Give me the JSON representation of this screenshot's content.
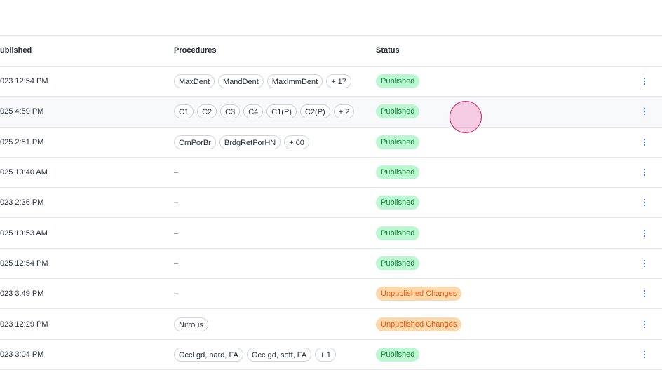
{
  "columns": {
    "published": "ublished",
    "procedures": "Procedures",
    "status": "Status"
  },
  "rows": [
    {
      "published": "023 12:54 PM",
      "procedures": [
        "MaxDent",
        "MandDent",
        "MaxImmDent",
        "+ 17"
      ],
      "status": "Published",
      "status_type": "published"
    },
    {
      "published": "025 4:59 PM",
      "procedures": [
        "C1",
        "C2",
        "C3",
        "C4",
        "C1(P)",
        "C2(P)",
        "+ 2"
      ],
      "status": "Published",
      "status_type": "published"
    },
    {
      "published": "025 2:51 PM",
      "procedures": [
        "CrnPorBr",
        "BrdgRetPorHN",
        "+ 60"
      ],
      "status": "Published",
      "status_type": "published"
    },
    {
      "published": "025 10:40 AM",
      "procedures": [],
      "status": "Published",
      "status_type": "published"
    },
    {
      "published": "023 2:36 PM",
      "procedures": [],
      "status": "Published",
      "status_type": "published"
    },
    {
      "published": "025 10:53 AM",
      "procedures": [],
      "status": "Published",
      "status_type": "published"
    },
    {
      "published": "025 12:54 PM",
      "procedures": [],
      "status": "Published",
      "status_type": "published"
    },
    {
      "published": "023 3:49 PM",
      "procedures": [],
      "status": "Unpublished Changes",
      "status_type": "unpublished"
    },
    {
      "published": "023 12:29 PM",
      "procedures": [
        "Nitrous"
      ],
      "status": "Unpublished Changes",
      "status_type": "unpublished"
    },
    {
      "published": "023 3:04 PM",
      "procedures": [
        "Occl gd, hard, FA",
        "Occ gd, soft, FA",
        "+ 1"
      ],
      "status": "Published",
      "status_type": "published"
    }
  ],
  "empty_procedures": "–",
  "icons": {
    "row_menu": "more-vertical-icon"
  },
  "colors": {
    "published_bg": "#bbf7d0",
    "published_text": "#15803d",
    "unpublished_bg": "#fed7aa",
    "unpublished_text": "#ea580c",
    "kebab": "#2563eb",
    "highlight_row": "#f8f9fb"
  }
}
